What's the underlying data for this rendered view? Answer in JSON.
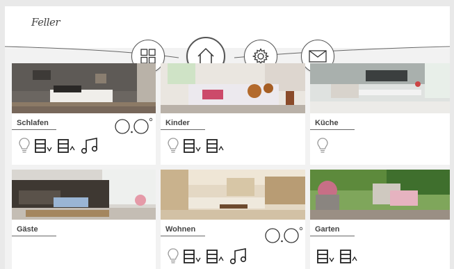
{
  "app": {
    "brand": "Feller"
  },
  "nav": {
    "buttons": [
      {
        "name": "grid-button",
        "icon": "grid-icon"
      },
      {
        "name": "home-button",
        "icon": "home-icon",
        "active": true
      },
      {
        "name": "settings-button",
        "icon": "gear-icon"
      },
      {
        "name": "messages-button",
        "icon": "envelope-icon"
      }
    ]
  },
  "rooms": [
    {
      "id": "schlafen",
      "label": "Schlafen",
      "functions": [
        "light",
        "blinds",
        "music"
      ],
      "climate_icon": "thermostat-rings-icon"
    },
    {
      "id": "kinder",
      "label": "Kinder",
      "functions": [
        "light",
        "blinds"
      ]
    },
    {
      "id": "kueche",
      "label": "Küche",
      "functions": [
        "light"
      ]
    },
    {
      "id": "gaeste",
      "label": "Gäste",
      "functions": []
    },
    {
      "id": "wohnen",
      "label": "Wohnen",
      "functions": [
        "light",
        "blinds",
        "music"
      ],
      "climate_icon": "thermostat-rings-icon"
    },
    {
      "id": "garten",
      "label": "Garten",
      "functions": [
        "blinds"
      ]
    }
  ],
  "colors": {
    "background": "#f2f2f2",
    "tile": "#ffffff",
    "icon": "#333333",
    "light_icon": "#9a9a9a"
  }
}
